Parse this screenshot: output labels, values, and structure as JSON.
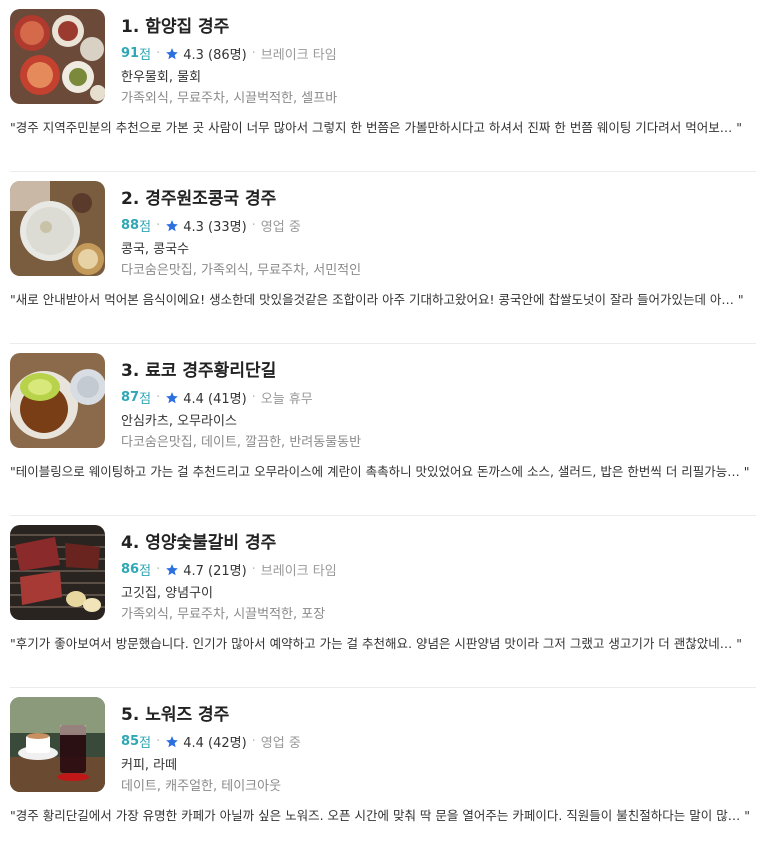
{
  "items": [
    {
      "title": "1. 함양집 경주",
      "score": "91",
      "score_unit": "점",
      "rating": "4.3 (86명)",
      "status": "브레이크 타임",
      "categories": "한우물회, 물회",
      "tags": "가족외식, 무료주차, 시끌벅적한, 셀프바",
      "review": "\"경주 지역주민분의 추천으로 가본 곳 사람이 너무 많아서 그렇지 한 번쯤은 가볼만하시다고 하셔서 진짜 한 번쯤 웨이팅 기다려서 먹어보…  \""
    },
    {
      "title": "2. 경주원조콩국 경주",
      "score": "88",
      "score_unit": "점",
      "rating": "4.3 (33명)",
      "status": "영업 중",
      "categories": "콩국, 콩국수",
      "tags": "다코숨은맛집, 가족외식, 무료주차, 서민적인",
      "review": "\"새로 안내받아서 먹어본 음식이에요! 생소한데 맛있을것같은 조합이라 아주 기대하고왔어요! 콩국안에 찹쌀도넛이 잘라 들어가있는데 아…  \""
    },
    {
      "title": "3. 료코 경주황리단길",
      "score": "87",
      "score_unit": "점",
      "rating": "4.4 (41명)",
      "status": "오늘 휴무",
      "categories": "안심카츠, 오무라이스",
      "tags": "다코숨은맛집, 데이트, 깔끔한, 반려동물동반",
      "review": "\"테이블링으로 웨이팅하고 가는 걸 추천드리고 오무라이스에 계란이 촉촉하니 맛있었어요 돈까스에 소스, 샐러드, 밥은 한번씩 더 리필가능…  \""
    },
    {
      "title": "4. 영양숯불갈비 경주",
      "score": "86",
      "score_unit": "점",
      "rating": "4.7 (21명)",
      "status": "브레이크 타임",
      "categories": "고깃집, 양념구이",
      "tags": "가족외식, 무료주차, 시끌벅적한, 포장",
      "review": "\"후기가 좋아보여서 방문했습니다. 인기가 많아서 예약하고 가는 걸 추천해요. 양념은 시판양념 맛이라 그저 그랬고 생고기가 더 괜찮았네…  \""
    },
    {
      "title": "5. 노워즈 경주",
      "score": "85",
      "score_unit": "점",
      "rating": "4.4 (42명)",
      "status": "영업 중",
      "categories": "커피, 라떼",
      "tags": "데이트, 캐주얼한, 테이크아웃",
      "review": "\"경주 황리단길에서 가장 유명한 카페가 아닐까 싶은 노워즈. 오픈 시간에 맞춰 딱 문을 열어주는 카페이다. 직원들이 불친절하다는 말이 많…  \""
    }
  ],
  "colors": {
    "score": "#2fa7b5",
    "star": "#2b6fe0",
    "tags": "#8a8a8a"
  }
}
